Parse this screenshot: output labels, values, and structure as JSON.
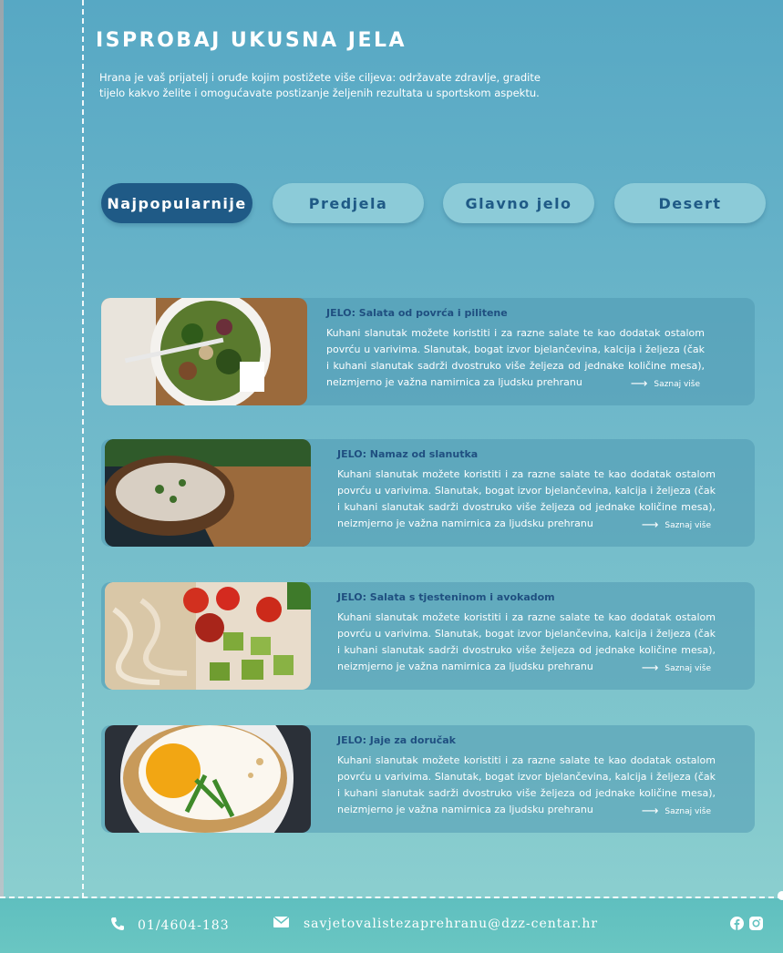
{
  "hero": {
    "title": "ISPROBAJ UKUSNA JELA",
    "text": "Hrana je vaš prijatelj i oruđe kojim postižete više ciljeva: održavate zdravlje, gradite tijelo kakvo želite i omogućavate postizanje željenih rezultata u sportskom aspektu."
  },
  "tabs": [
    {
      "label": "Najpopularnije",
      "active": true
    },
    {
      "label": "Predjela",
      "active": false
    },
    {
      "label": "Glavno jelo",
      "active": false
    },
    {
      "label": "Desert",
      "active": false
    }
  ],
  "cards": [
    {
      "title": "JELO: Salata od povrća i pilitene",
      "text": "Kuhani slanutak možete koristiti i za razne salate te kao dodatak ostalom povrću u varivima. Slanutak, bogat izvor bjelančevina, kalcija i željeza (čak i kuhani slanutak sadrži dvostruko više željeza od jednake količine mesa), neizmjerno je važna namirnica za ljudsku prehranu",
      "more": "Saznaj više",
      "image_icon": "salad-photo"
    },
    {
      "title": "JELO: Namaz od slanutka",
      "text": "Kuhani slanutak možete koristiti i za razne salate te kao dodatak ostalom povrću u varivima. Slanutak, bogat izvor bjelančevina, kalcija i željeza (čak i kuhani slanutak sadrži dvostruko više željeza od jednake količine mesa), neizmjerno je važna namirnica za ljudsku prehranu",
      "more": "Saznaj više",
      "image_icon": "toast-spread-photo"
    },
    {
      "title": "JELO: Salata s tjesteninom i avokadom",
      "text": "Kuhani slanutak možete koristiti i za razne salate te kao dodatak ostalom povrću u varivima. Slanutak, bogat izvor bjelančevina, kalcija i željeza (čak i kuhani slanutak sadrži dvostruko više željeza od jednake količine mesa), neizmjerno je važna namirnica za ljudsku prehranu",
      "more": "Saznaj više",
      "image_icon": "pasta-avocado-photo"
    },
    {
      "title": "JELO: Jaje za doručak",
      "text": "Kuhani slanutak možete koristiti i za razne salate te kao dodatak ostalom povrću u varivima. Slanutak, bogat izvor bjelančevina, kalcija i željeza (čak i kuhani slanutak sadrži dvostruko više željeza od jednake količine mesa), neizmjerno je važna namirnica za ljudsku prehranu",
      "more": "Saznaj više",
      "image_icon": "fried-egg-photo"
    }
  ],
  "footer": {
    "phone": "01/4604-183",
    "email": "savjetovalistezaprehranu@dzz-centar.hr",
    "social_icons": [
      "facebook-icon",
      "instagram-icon"
    ]
  },
  "colors": {
    "accent": "#1f5a86",
    "tab_bg": "#8ccbd8",
    "footer_bg": "#62c2c0"
  }
}
